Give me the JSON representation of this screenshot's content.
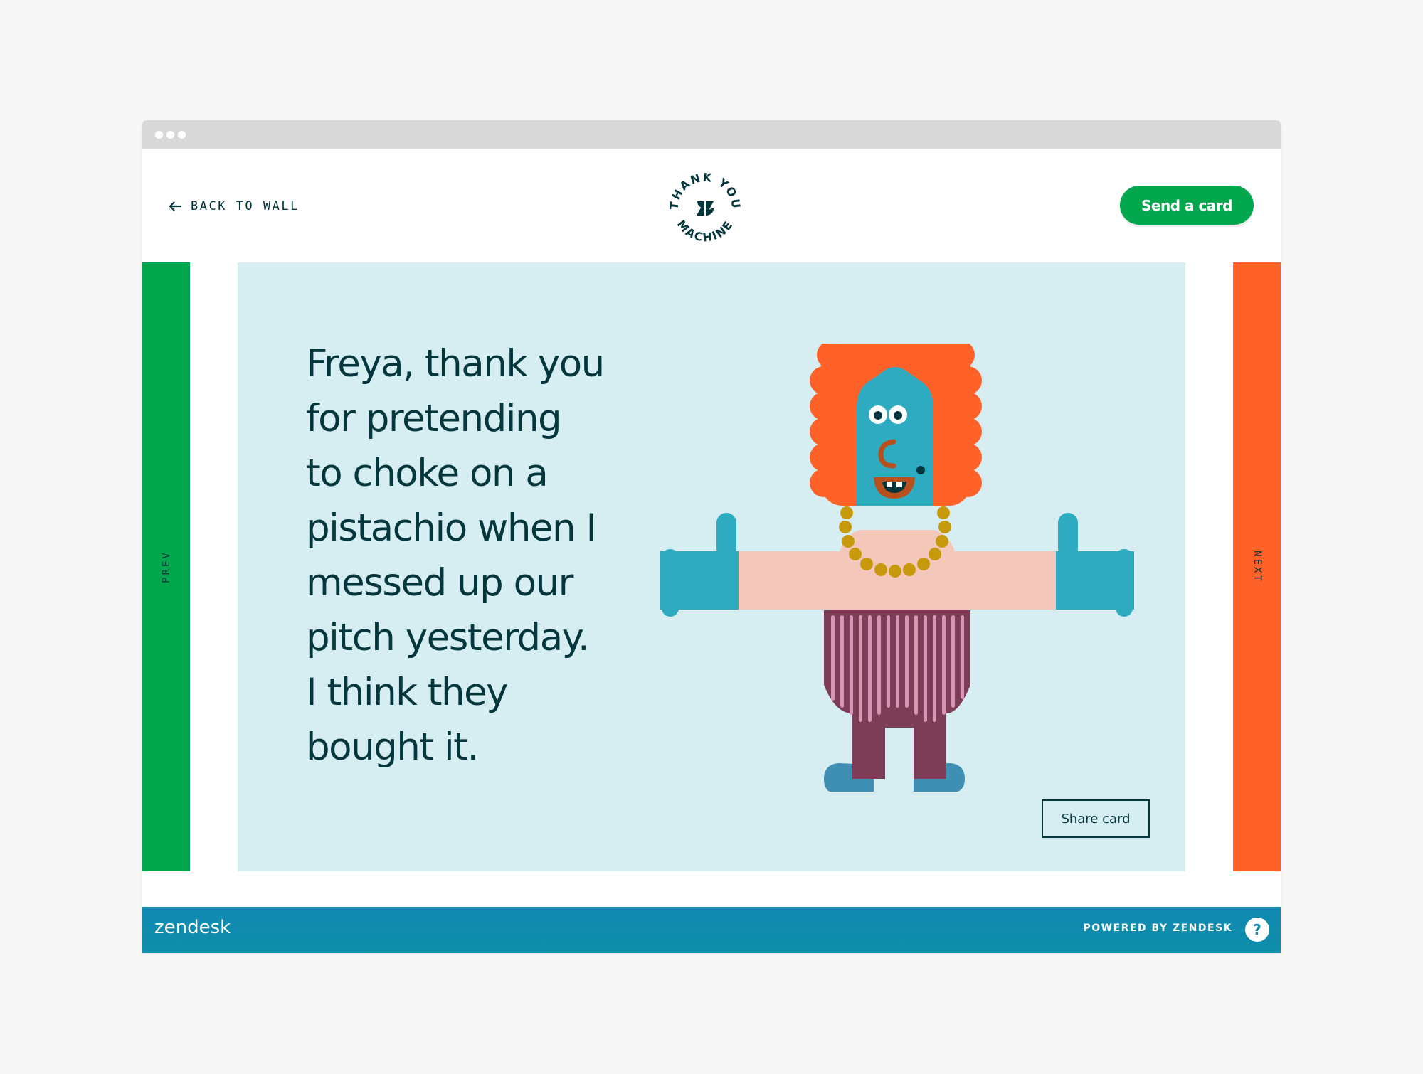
{
  "browser": {
    "dots": 3
  },
  "header": {
    "back_label": "BACK TO WALL",
    "logo_text_top": "THANK YOU",
    "logo_text_bottom": "MACHINE",
    "send_label": "Send a card"
  },
  "nav": {
    "prev_label": "PREV",
    "next_label": "NEXT"
  },
  "card": {
    "message_lines": [
      "Freya, thank you",
      "for pretending",
      "to choke on a",
      "pistachio when I",
      "messed up our",
      "pitch yesterday.",
      "I think they",
      "bought it."
    ],
    "share_label": "Share card"
  },
  "footer": {
    "brand": "zendesk",
    "powered": "POWERED BY ZENDESK",
    "help": "?"
  },
  "colors": {
    "dark_teal": "#03363d",
    "green": "#03a84e",
    "orange": "#ff6229",
    "card_bg": "#d6eef1",
    "footer_blue": "#0e8ea9"
  }
}
